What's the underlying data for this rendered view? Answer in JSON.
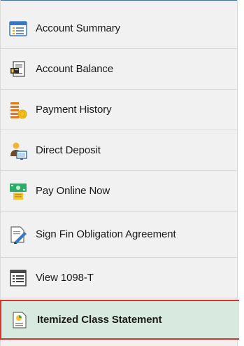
{
  "menu": {
    "items": [
      {
        "label": "Account Summary",
        "icon": "account-summary-icon"
      },
      {
        "label": "Account Balance",
        "icon": "account-balance-icon"
      },
      {
        "label": "Payment History",
        "icon": "payment-history-icon"
      },
      {
        "label": "Direct Deposit",
        "icon": "direct-deposit-icon"
      },
      {
        "label": "Pay Online Now",
        "icon": "pay-online-icon"
      },
      {
        "label": "Sign Fin Obligation Agreement",
        "icon": "sign-agreement-icon"
      },
      {
        "label": "View 1098-T",
        "icon": "view-1098t-icon"
      },
      {
        "label": "Itemized Class Statement",
        "icon": "itemized-statement-icon",
        "selected": true
      }
    ]
  },
  "colors": {
    "selected_background": "#d8eadf",
    "selected_border": "#d9342b",
    "menu_background": "#f1f1f1"
  }
}
